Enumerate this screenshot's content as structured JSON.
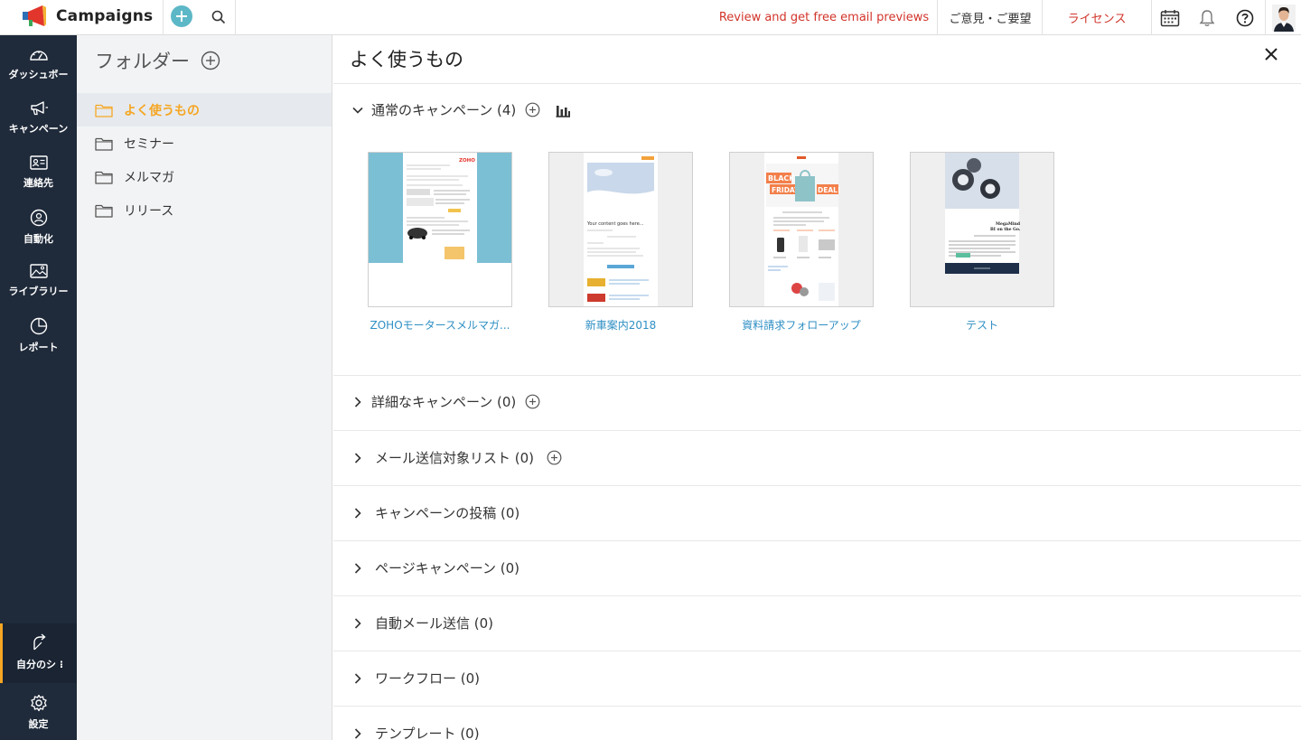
{
  "app": {
    "name": "Campaigns"
  },
  "topbar": {
    "promo": "Review and get free email previews",
    "feedback": "ご意見・ご要望",
    "license": "ライセンス"
  },
  "nav": [
    {
      "label": "ダッシュボー",
      "icon": "dashboard-icon"
    },
    {
      "label": "キャンペーン",
      "icon": "megaphone-icon"
    },
    {
      "label": "連絡先",
      "icon": "contacts-icon"
    },
    {
      "label": "自動化",
      "icon": "automation-icon"
    },
    {
      "label": "ライブラリー",
      "icon": "library-icon"
    },
    {
      "label": "レポート",
      "icon": "report-icon"
    }
  ],
  "nav_bottom": {
    "shortcut": "自分のシ",
    "settings": "設定"
  },
  "folders": {
    "title": "フォルダー",
    "items": [
      "よく使うもの",
      "セミナー",
      "メルマガ",
      "リリース"
    ],
    "active": "よく使うもの"
  },
  "main": {
    "title": "よく使うもの",
    "sections": [
      {
        "label": "通常のキャンペーン (4)",
        "expanded": true
      },
      {
        "label": "詳細なキャンペーン (0)"
      },
      {
        "label": "メール送信対象リスト (0)"
      },
      {
        "label": "キャンペーンの投稿 (0)"
      },
      {
        "label": "ページキャンペーン (0)"
      },
      {
        "label": "自動メール送信 (0)"
      },
      {
        "label": "ワークフロー (0)"
      },
      {
        "label": "テンプレート (0)"
      }
    ],
    "campaigns": [
      {
        "name": "ZOHOモータースメルマガ...",
        "thumb": {
          "logo": "ZOHO"
        }
      },
      {
        "name": "新車案内2018",
        "thumb": {
          "headline": "Your content goes here..."
        }
      },
      {
        "name": "資料請求フォローアップ",
        "thumb": {
          "banner_1": "BLACK",
          "banner_2": "FRIDAY",
          "banner_3": "DEAL!"
        }
      },
      {
        "name": "テスト",
        "thumb": {
          "headline_1": "MegaMind",
          "headline_2": "BI on the Go."
        }
      }
    ]
  },
  "colors": {
    "accent": "#f5a623",
    "nav_bg": "#1f2a3a",
    "link": "#2f8fc4",
    "alert": "#d2342a",
    "add": "#5cb8c7"
  }
}
